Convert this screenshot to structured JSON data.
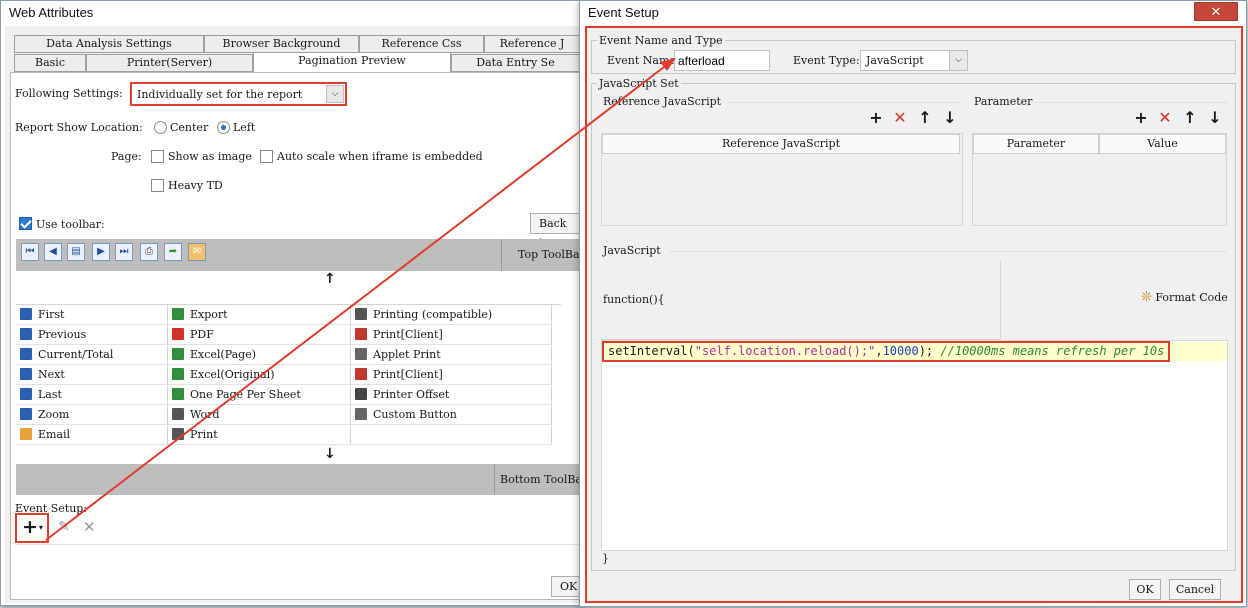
{
  "left": {
    "title": "Web Attributes",
    "tabs_row1": [
      "Data Analysis Settings",
      "Browser Background",
      "Reference Css",
      "Reference J"
    ],
    "tabs_row2": [
      "Basic",
      "Printer(Server)",
      "Pagination Preview",
      "Data Entry Se"
    ],
    "following_label": "Following Settings:",
    "following_value": "Individually set for the report",
    "show_location_label": "Report Show Location:",
    "center_label": "Center",
    "left_label": "Left",
    "page_label": "Page:",
    "show_as_image": "Show as image",
    "auto_scale": "Auto scale when iframe is embedded",
    "heavy_td": "Heavy TD",
    "use_toolbar": "Use toolbar:",
    "back_to": "Back to",
    "top_toolbar": "Top ToolBa",
    "bottom_toolbar": "Bottom ToolBa",
    "up_arrow": "↑",
    "down_arrow": "↓",
    "event_setup_label": "Event Setup:",
    "ok": "OK",
    "items": [
      {
        "label": "First",
        "icon": "first-icon",
        "color": "#2b5fb0"
      },
      {
        "label": "Export",
        "icon": "export-icon",
        "color": "#2f8f3a"
      },
      {
        "label": "Printing (compatible)",
        "icon": "print-icon",
        "color": "#555555"
      },
      {
        "label": "Previous",
        "icon": "previous-icon",
        "color": "#2b5fb0"
      },
      {
        "label": "PDF",
        "icon": "pdf-icon",
        "color": "#d2302a"
      },
      {
        "label": "Print[Client]",
        "icon": "print-client-icon",
        "color": "#c0392b"
      },
      {
        "label": "Current/Total",
        "icon": "current-total-icon",
        "color": "#2b5fb0"
      },
      {
        "label": "Excel(Page)",
        "icon": "excel-icon",
        "color": "#2f8f3a"
      },
      {
        "label": "Applet Print",
        "icon": "applet-print-icon",
        "color": "#666666"
      },
      {
        "label": "Next",
        "icon": "next-icon",
        "color": "#2b5fb0"
      },
      {
        "label": "Excel(Original)",
        "icon": "excel-icon",
        "color": "#2f8f3a"
      },
      {
        "label": "Print[Client]",
        "icon": "print-client-icon",
        "color": "#c0392b"
      },
      {
        "label": "Last",
        "icon": "last-icon",
        "color": "#2b5fb0"
      },
      {
        "label": "One Page Per Sheet",
        "icon": "excel-icon",
        "color": "#2f8f3a"
      },
      {
        "label": "Printer Offset",
        "icon": "printer-offset-icon",
        "color": "#444444"
      },
      {
        "label": "Zoom",
        "icon": "zoom-icon",
        "color": "#2b5fb0"
      },
      {
        "label": "Word",
        "icon": "word-icon",
        "color": "#555555"
      },
      {
        "label": "Custom Button",
        "icon": "gear-icon",
        "color": "#666666"
      },
      {
        "label": "Email",
        "icon": "email-icon",
        "color": "#e8a23c"
      },
      {
        "label": "Print",
        "icon": "print-icon",
        "color": "#555555"
      },
      {
        "label": "",
        "icon": "",
        "color": "#ffffff"
      }
    ]
  },
  "right": {
    "title": "Event Setup",
    "name_type_group": "Event Name and Type",
    "event_name_label": "Event Name:",
    "event_name_value": "afterload",
    "event_type_label": "Event Type:",
    "event_type_value": "JavaScript",
    "js_set_group": "JavaScript Set",
    "ref_js_label": "Reference JavaScript",
    "param_label": "Parameter",
    "ref_js_col": "Reference JavaScript",
    "param_col": "Parameter",
    "value_col": "Value",
    "javascript_label": "JavaScript",
    "function_text": "function(){",
    "format_code": "Format Code",
    "code_fn": "setInterval",
    "code_str": "\"self.location.reload();\"",
    "code_num": "10000",
    "code_comment": "//10000ms means refresh per 10s",
    "closing_brace": "}",
    "ok": "OK",
    "cancel": "Cancel"
  },
  "colors": {
    "accent": "#e03c2c",
    "close": "#c7463a",
    "highlight": "#ffffcc",
    "comment": "#2e8b2e",
    "string": "#b22b9a",
    "number": "#1f3fbf"
  }
}
